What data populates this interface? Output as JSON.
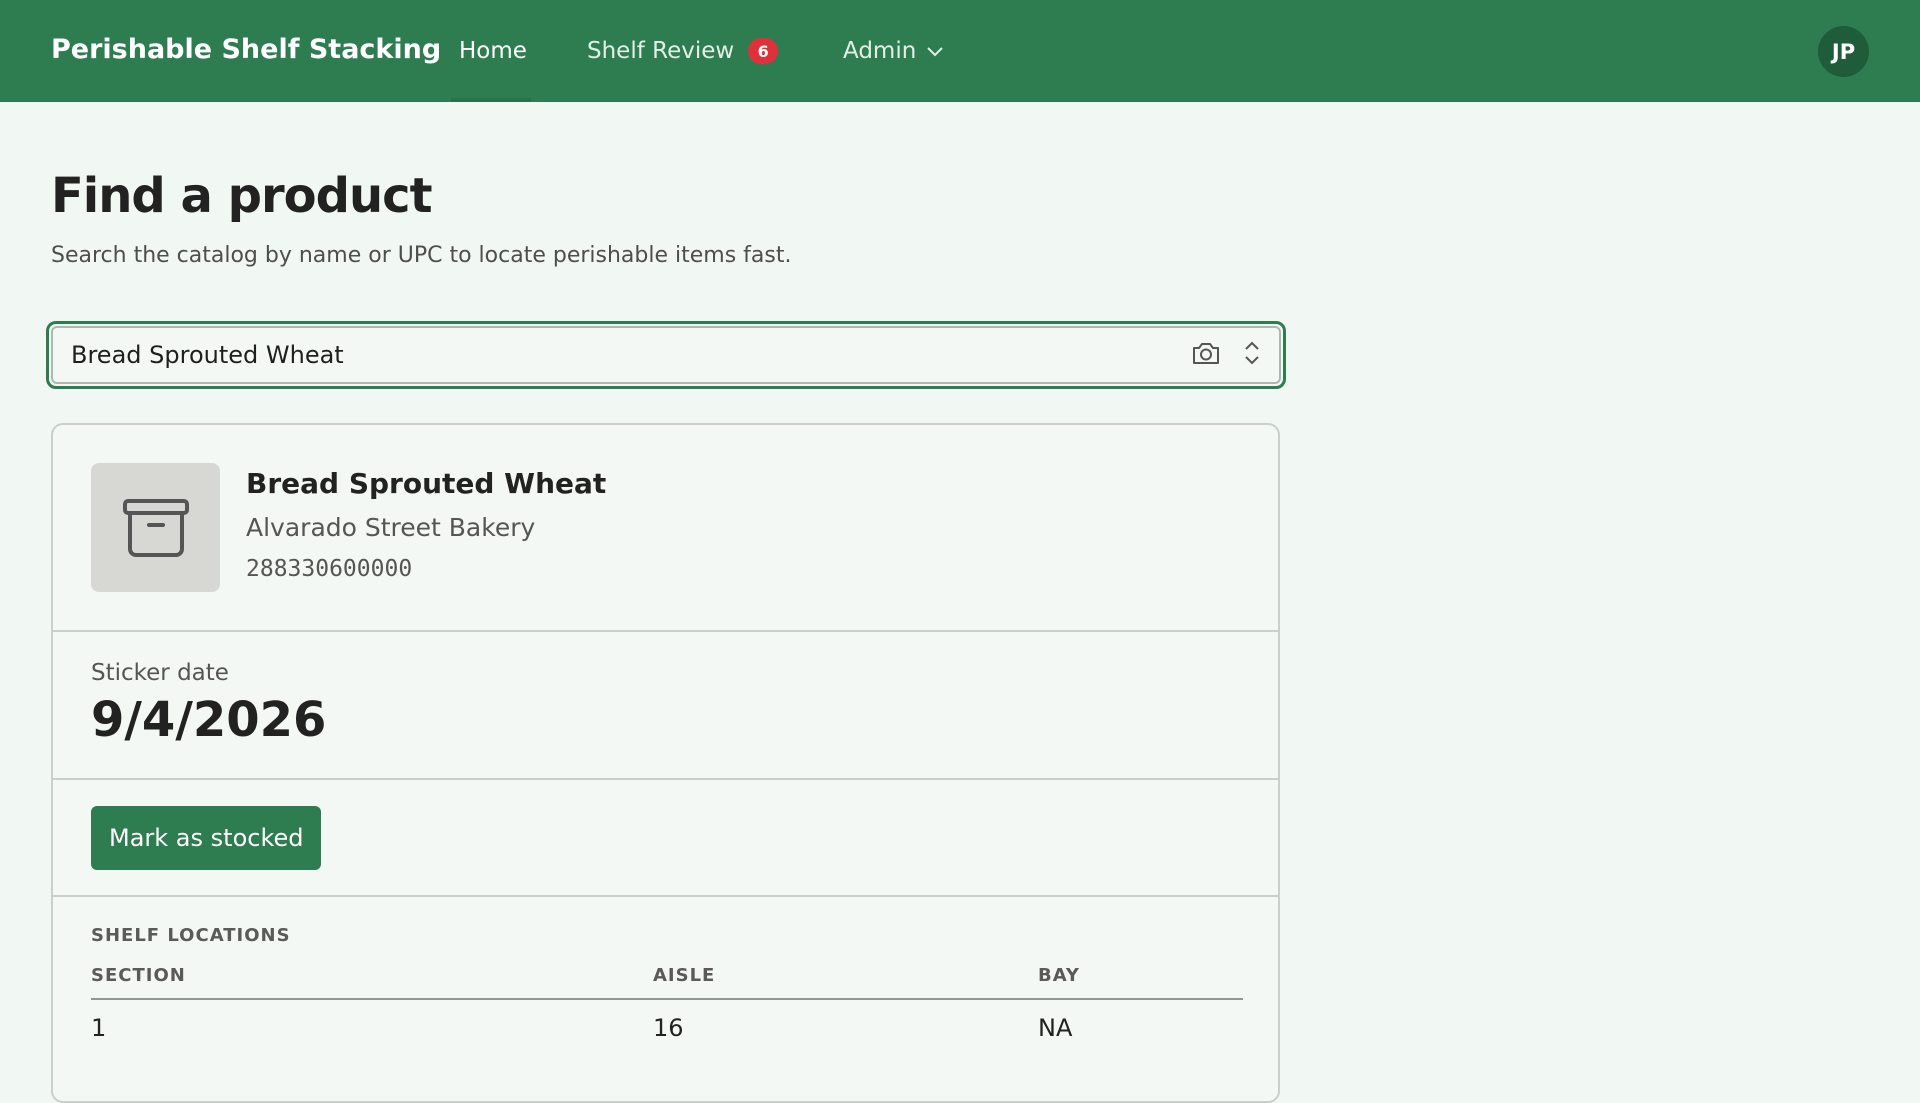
{
  "app": {
    "brand": "Perishable Shelf Stacking",
    "nav": {
      "home": "Home",
      "shelf_review": "Shelf Review",
      "shelf_review_count": "6",
      "admin": "Admin"
    },
    "user_initials": "JP",
    "accent_color": "#2e7d50",
    "badge_color": "#e0303a"
  },
  "page": {
    "title": "Find a product",
    "subtitle": "Search the catalog by name or UPC to locate perishable items fast."
  },
  "search": {
    "value": "Bread Sprouted Wheat",
    "camera_icon": "camera-icon",
    "toggle_icon": "chevron-up-down-icon"
  },
  "product": {
    "name": "Bread Sprouted Wheat",
    "brand": "Alvarado Street Bakery",
    "upc": "288330600000",
    "thumbnail_icon": "archive-box-icon"
  },
  "sticker": {
    "label": "Sticker date",
    "date": "9/4/2026"
  },
  "actions": {
    "mark_stocked": "Mark as stocked"
  },
  "shelf_locations": {
    "heading": "SHELF LOCATIONS",
    "columns": [
      "SECTION",
      "AISLE",
      "BAY"
    ],
    "rows": [
      {
        "section": "1",
        "aisle": "16",
        "bay": "NA"
      }
    ]
  }
}
